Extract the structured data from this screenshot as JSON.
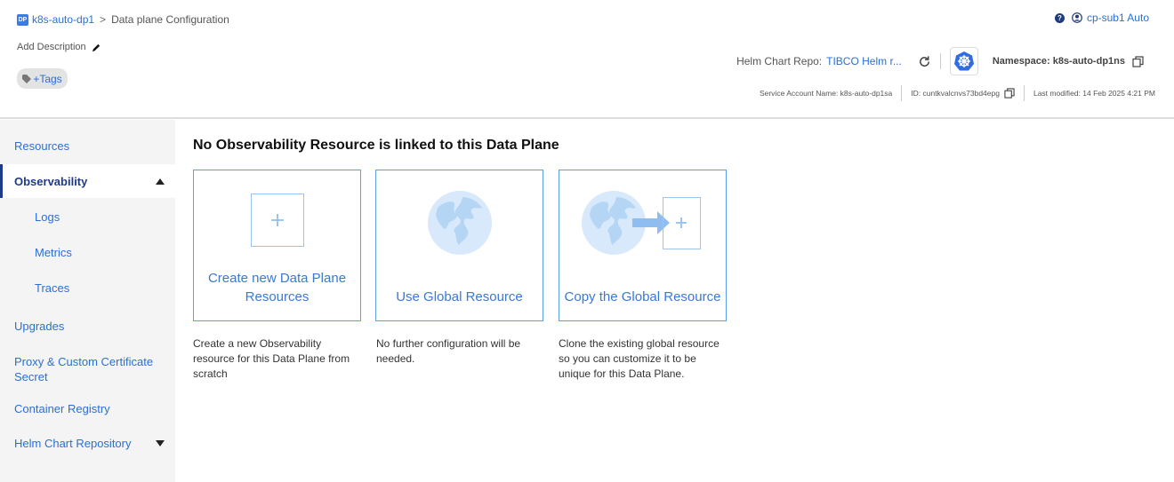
{
  "breadcrumb": {
    "badge": "DP",
    "dataplane": "k8s-auto-dp1",
    "separator": ">",
    "page": "Data plane Configuration"
  },
  "header": {
    "add_description": "Add Description",
    "tags": "+Tags",
    "help": "?",
    "user": "cp-sub1 Auto",
    "helm_label": "Helm Chart Repo:",
    "helm_value": "TIBCO Helm r...",
    "namespace": "Namespace: k8s-auto-dp1ns",
    "service_account": "Service Account Name: k8s-auto-dp1sa",
    "id": "ID: cuntkvalcnvs73bd4epg",
    "last_modified": "Last modified: 14 Feb 2025 4:21 PM"
  },
  "sidebar": {
    "items": [
      {
        "label": "Resources"
      },
      {
        "label": "Observability"
      },
      {
        "label": "Logs"
      },
      {
        "label": "Metrics"
      },
      {
        "label": "Traces"
      },
      {
        "label": "Upgrades"
      },
      {
        "label": "Proxy & Custom Certificate Secret"
      },
      {
        "label": "Container Registry"
      },
      {
        "label": "Helm Chart Repository"
      }
    ]
  },
  "main": {
    "title": "No Observability Resource is linked to this Data Plane",
    "cards": [
      {
        "title": "Create new Data Plane Resources",
        "desc": "Create a new Observability resource for this Data Plane from scratch"
      },
      {
        "title": "Use Global Resource",
        "desc": "No further configuration will be needed."
      },
      {
        "title": "Copy the Global Resource",
        "desc": "Clone the existing global resource so you can customize it to be unique for this Data Plane."
      }
    ]
  }
}
